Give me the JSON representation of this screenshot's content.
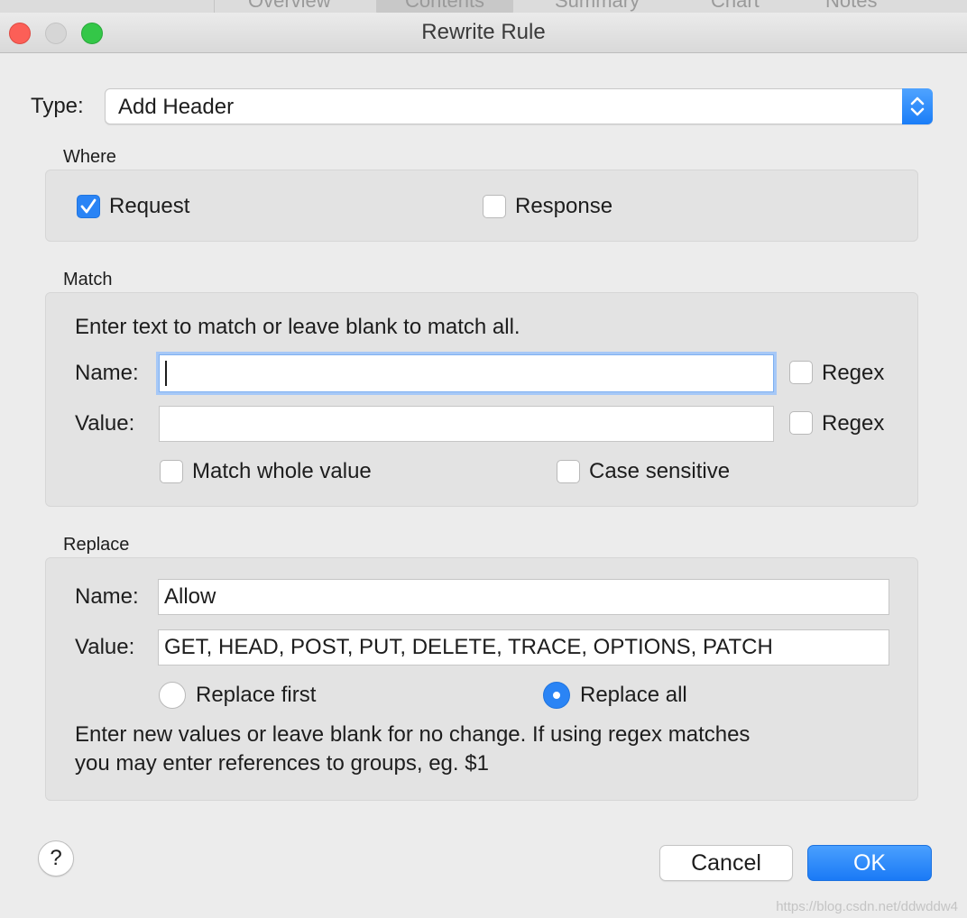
{
  "background_tabs": [
    "Overview",
    "Contents",
    "Summary",
    "Chart",
    "Notes"
  ],
  "window": {
    "title": "Rewrite Rule"
  },
  "type": {
    "label": "Type:",
    "value": "Add Header"
  },
  "where": {
    "title": "Where",
    "request": {
      "label": "Request",
      "checked": true
    },
    "response": {
      "label": "Response",
      "checked": false
    }
  },
  "match": {
    "title": "Match",
    "hint": "Enter text to match or leave blank to match all.",
    "name_label": "Name:",
    "name_value": "",
    "value_label": "Value:",
    "value_value": "",
    "regex_label": "Regex",
    "name_regex": false,
    "value_regex": false,
    "match_whole_label": "Match whole value",
    "match_whole": false,
    "case_sensitive_label": "Case sensitive",
    "case_sensitive": false
  },
  "replace": {
    "title": "Replace",
    "name_label": "Name:",
    "name_value": "Allow",
    "value_label": "Value:",
    "value_value": "GET, HEAD, POST, PUT, DELETE, TRACE, OPTIONS, PATCH",
    "replace_first_label": "Replace first",
    "replace_all_label": "Replace all",
    "selected": "replace_all",
    "note_line1": "Enter new values or leave blank for no change. If using regex matches",
    "note_line2": "you may enter references to groups, eg. $1"
  },
  "buttons": {
    "help": "?",
    "cancel": "Cancel",
    "ok": "OK"
  },
  "watermark": "https://blog.csdn.net/ddwddw4",
  "colors": {
    "accent": "#2a84f5",
    "close": "#fc5f57",
    "maximize": "#34c748"
  }
}
